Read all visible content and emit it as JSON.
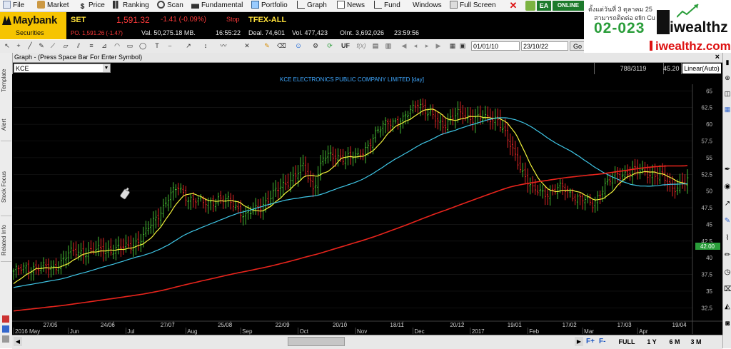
{
  "menu": {
    "items": [
      "File",
      "Market",
      "Price",
      "Ranking",
      "Scan",
      "Fundamental",
      "Portfolio",
      "Graph",
      "News",
      "Fund",
      "Windows",
      "Full Screen"
    ],
    "ea": "EA",
    "online": "ONLINE"
  },
  "brand": {
    "name": "Maybank",
    "sub": "Securities"
  },
  "ticker": {
    "set_label": "SET",
    "set_value": "1,591.32",
    "set_change": "-1.41 (-0.09%)",
    "stop": "Stop",
    "po": "PO. 1,591.26 (-1.47)",
    "value": "Val. 50,275.18 MB.",
    "time1": "16:55:22",
    "tfex": "TFEX-ALL",
    "deal": "Deal. 74,601",
    "vol": "Vol. 477,423",
    "oint": "OInt. 3,692,026",
    "time2": "23:59:56"
  },
  "toolbar": {
    "uf": "UF",
    "date_from": "01/01/10",
    "date_to": "23/10/22",
    "go": "Go"
  },
  "ad": {
    "thai_line1": "ตั้งแต่วันที่ 3 ตุลาคม 25",
    "thai_line2": "สามารถติดต่อ efin Cu",
    "phone": "02-023",
    "brand": "iwealthz",
    "domain": "iwealthz.com"
  },
  "graph": {
    "window_title": "Graph - (Press Space Bar For Enter Symbol)",
    "symbol_input": "KCE",
    "count": "788/3119",
    "last_value": "45.20",
    "scale": "Linear(Auto)",
    "price_tag": "42.00"
  },
  "side_tabs": [
    "Template",
    "Alert",
    "Stock Focus",
    "Related Info"
  ],
  "bottom": {
    "ranges": [
      "FULL",
      "1 Y",
      "6 M",
      "3 M"
    ],
    "f_plus": "F+",
    "f_minus": "F-"
  },
  "chart_data": {
    "type": "line",
    "title": "KCE ELECTRONICS PUBLIC COMPANY LIMITED [day]",
    "ylim": [
      30.5,
      66
    ],
    "y_ticks": [
      32.5,
      35,
      37.5,
      40,
      42.5,
      45,
      47.5,
      50,
      52.5,
      55,
      57.5,
      60,
      62.5,
      65
    ],
    "x_labels_top": [
      "27/05",
      "24/06",
      "27/07",
      "25/08",
      "22/09",
      "20/10",
      "18/11",
      "20/12",
      "19/01",
      "17/02",
      "17/03",
      "19/04"
    ],
    "x_labels_bottom": [
      "2016 May",
      "Jun",
      "Jul",
      "Aug",
      "Sep",
      "Oct",
      "Nov",
      "Dec",
      "2017",
      "Feb",
      "Mar",
      "Apr"
    ],
    "x_index_range": [
      0,
      240
    ],
    "x_labels_top_index": [
      17,
      40,
      64,
      87,
      110,
      133,
      156,
      180,
      203,
      225,
      247,
      269
    ],
    "x_labels_bottom_index": [
      0,
      22,
      45,
      69,
      91,
      114,
      137,
      160,
      183,
      206,
      228,
      250
    ],
    "price_keypoints": [
      [
        0,
        38.0
      ],
      [
        8,
        38.6
      ],
      [
        16,
        38.4
      ],
      [
        22,
        40.6
      ],
      [
        30,
        41.0
      ],
      [
        38,
        41.2
      ],
      [
        46,
        41.6
      ],
      [
        52,
        43.2
      ],
      [
        58,
        46.5
      ],
      [
        62,
        49.0
      ],
      [
        66,
        50.5
      ],
      [
        70,
        49.0
      ],
      [
        76,
        48.2
      ],
      [
        82,
        48.8
      ],
      [
        88,
        48.2
      ],
      [
        93,
        46.2
      ],
      [
        98,
        47.5
      ],
      [
        104,
        49.5
      ],
      [
        110,
        51.5
      ],
      [
        116,
        53.5
      ],
      [
        120,
        50.5
      ],
      [
        124,
        55.0
      ],
      [
        132,
        55.2
      ],
      [
        138,
        55.0
      ],
      [
        144,
        58.0
      ],
      [
        150,
        60.5
      ],
      [
        156,
        60.5
      ],
      [
        162,
        63.5
      ],
      [
        166,
        61.5
      ],
      [
        172,
        60.0
      ],
      [
        178,
        61.5
      ],
      [
        184,
        61.0
      ],
      [
        188,
        60.8
      ],
      [
        194,
        61.0
      ],
      [
        198,
        57.5
      ],
      [
        204,
        53.0
      ],
      [
        208,
        50.0
      ],
      [
        214,
        49.8
      ],
      [
        220,
        50.5
      ],
      [
        226,
        49.0
      ],
      [
        232,
        48.0
      ],
      [
        236,
        50.5
      ],
      [
        242,
        52.5
      ],
      [
        248,
        53.0
      ],
      [
        254,
        52.8
      ],
      [
        260,
        52.0
      ],
      [
        264,
        50.5
      ],
      [
        270,
        51.5
      ]
    ],
    "series": [
      {
        "name": "",
        "color": "#f2f23a",
        "period": 10
      },
      {
        "name": "",
        "color": "#3fc6e6",
        "period": 50
      },
      {
        "name": "",
        "color": "#e8241c",
        "period": 200
      }
    ]
  }
}
